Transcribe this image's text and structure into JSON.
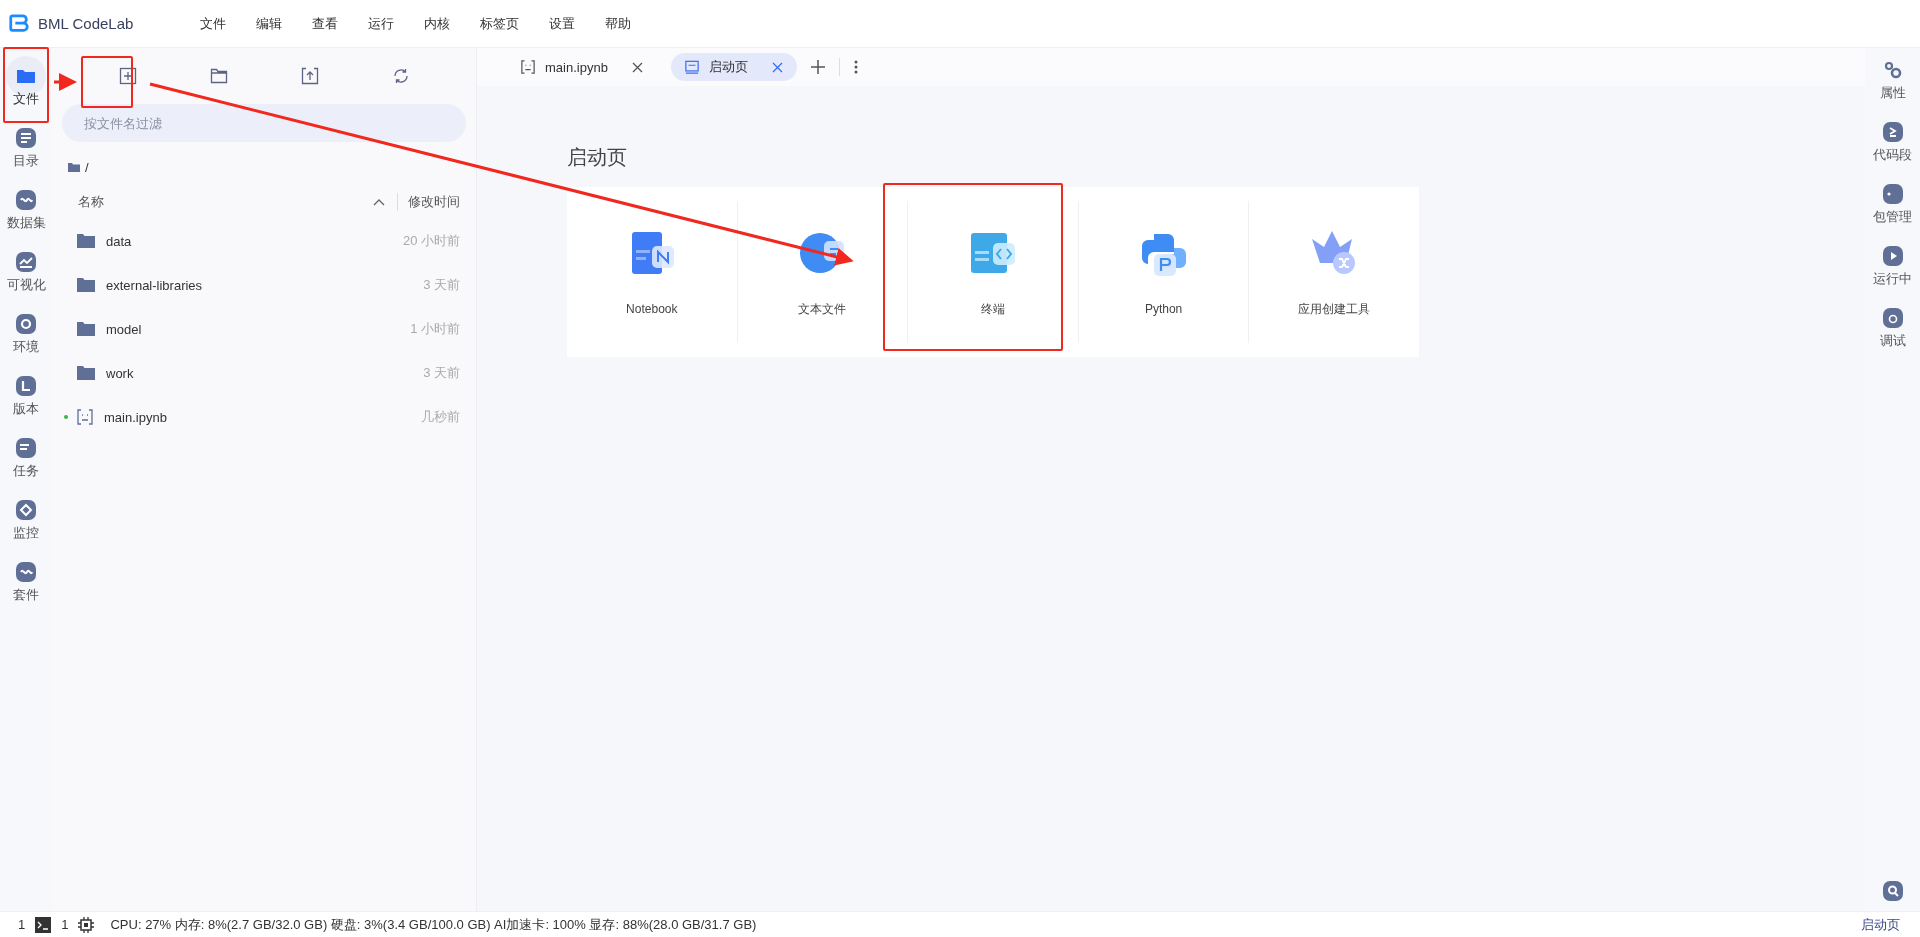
{
  "app": {
    "name": "BML CodeLab"
  },
  "menu": [
    "文件",
    "编辑",
    "查看",
    "运行",
    "内核",
    "标签页",
    "设置",
    "帮助"
  ],
  "sidebar": {
    "items": [
      {
        "label": "文件",
        "selected": true
      },
      {
        "label": "目录",
        "selected": false
      },
      {
        "label": "数据集",
        "selected": false
      },
      {
        "label": "可视化",
        "selected": false
      },
      {
        "label": "环境",
        "selected": false
      },
      {
        "label": "版本",
        "selected": false
      },
      {
        "label": "任务",
        "selected": false
      },
      {
        "label": "监控",
        "selected": false
      },
      {
        "label": "套件",
        "selected": false
      }
    ]
  },
  "file_browser": {
    "filter": {
      "placeholder": "按文件名过滤"
    },
    "path": "/",
    "columns": [
      "名称",
      "修改时间"
    ],
    "rows": [
      {
        "kind": "folder",
        "name": "data",
        "modified": "20 小时前",
        "running": false
      },
      {
        "kind": "folder",
        "name": "external-libraries",
        "modified": "3 天前",
        "running": false
      },
      {
        "kind": "folder",
        "name": "model",
        "modified": "1 小时前",
        "running": false
      },
      {
        "kind": "folder",
        "name": "work",
        "modified": "3 天前",
        "running": false
      },
      {
        "kind": "notebook",
        "name": "main.ipynb",
        "modified": "几秒前",
        "running": true
      }
    ]
  },
  "tabs": [
    {
      "kind": "notebook",
      "label": "main.ipynb",
      "selected": false
    },
    {
      "kind": "launcher",
      "label": "启动页",
      "selected": true
    }
  ],
  "launcher": {
    "title": "启动页",
    "cards": [
      {
        "kind": "notebook",
        "label": "Notebook"
      },
      {
        "kind": "text",
        "label": "文本文件"
      },
      {
        "kind": "terminal",
        "label": "终端"
      },
      {
        "kind": "python",
        "label": "Python"
      },
      {
        "kind": "app",
        "label": "应用创建工具"
      }
    ]
  },
  "right_sidebar": {
    "items": [
      "属性",
      "代码段",
      "包管理",
      "运行中",
      "调试"
    ]
  },
  "status_bar": {
    "kernels": "1",
    "terminals": "1",
    "resources": "CPU:  27% 内存:  8%(2.7 GB/32.0 GB) 硬盘:  3%(3.4 GB/100.0 GB)  AI加速卡:  100%  显存:  88%(28.0 GB/31.7 GB)",
    "current": "启动页"
  }
}
